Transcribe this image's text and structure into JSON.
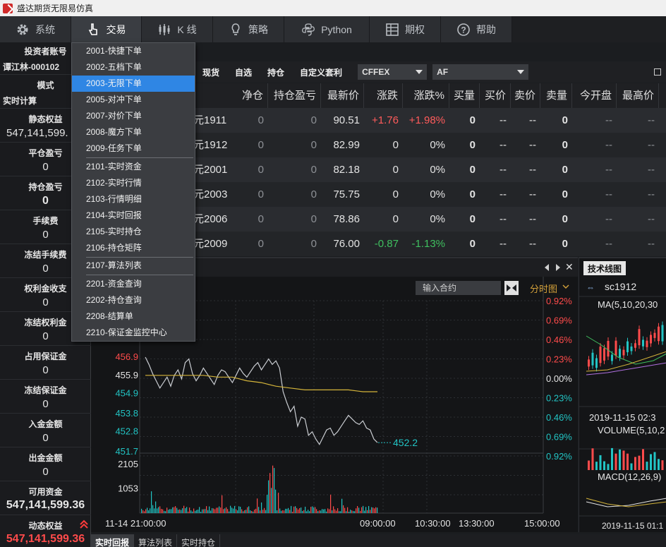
{
  "window": {
    "title": "盛达期货无限易仿真"
  },
  "menubar": {
    "items": [
      {
        "label": "系统",
        "icon": "gear-icon"
      },
      {
        "label": "交易",
        "icon": "hand-pointer-icon"
      },
      {
        "label": "K 线",
        "icon": "candlestick-icon"
      },
      {
        "label": "策略",
        "icon": "lightbulb-icon"
      },
      {
        "label": "Python",
        "icon": "python-icon"
      },
      {
        "label": "期权",
        "icon": "grid-icon"
      },
      {
        "label": "帮助",
        "icon": "help-icon"
      }
    ]
  },
  "account": {
    "rows": [
      {
        "label": "投资者账号",
        "value": "谭江林-000102"
      },
      {
        "label": "模式",
        "value": "实时计算"
      },
      {
        "label": "静态权益",
        "value": "547,141,599."
      },
      {
        "label": "平仓盈亏",
        "value": "0"
      },
      {
        "label": "持仓盈亏",
        "value": "0"
      },
      {
        "label": "手续费",
        "value": "0"
      },
      {
        "label": "冻结手续费",
        "value": "0"
      },
      {
        "label": "权利金收支",
        "value": "0"
      },
      {
        "label": "冻结权利金",
        "value": "0"
      },
      {
        "label": "占用保证金",
        "value": "0"
      },
      {
        "label": "冻结保证金",
        "value": "0"
      },
      {
        "label": "入金金额",
        "value": "0"
      },
      {
        "label": "出金金额",
        "value": "0"
      },
      {
        "label": "可用资金",
        "value": "547,141,599.36"
      },
      {
        "label": "动态权益",
        "value": "547,141,599.36"
      }
    ]
  },
  "dropdown": {
    "items": [
      "2001-快捷下单",
      "2002-五档下单",
      "2003-无限下单",
      "2005-对冲下单",
      "2007-对价下单",
      "2008-魔方下单",
      "2009-任务下单",
      "2101-实时资金",
      "2102-实时行情",
      "2103-行情明细",
      "2104-实时回报",
      "2105-实时持仓",
      "2106-持仓矩阵",
      "2107-算法列表",
      "2201-资金查询",
      "2202-持仓查询",
      "2208-结算单",
      "2210-保证金监控中心"
    ]
  },
  "filters": {
    "tabs": [
      "现货",
      "自选",
      "持仓",
      "自定义套利"
    ],
    "exchange": "CFFEX",
    "product": "AF"
  },
  "quote_table": {
    "headers": [
      "净仓",
      "持仓盈亏",
      "最新价",
      "涨跌",
      "涨跌%",
      "买量",
      "买价",
      "卖价",
      "卖量",
      "今开盘",
      "最高价"
    ],
    "rows": [
      {
        "name": "元1911",
        "net": "0",
        "pnl": "0",
        "last": "90.51",
        "chg": "+1.76",
        "pct": "+1.98%",
        "bidv": "0",
        "bid": "--",
        "ask": "--",
        "askv": "0",
        "open": "--",
        "high": "--",
        "dir": "up"
      },
      {
        "name": "元1912",
        "net": "0",
        "pnl": "0",
        "last": "82.99",
        "chg": "0",
        "pct": "0%",
        "bidv": "0",
        "bid": "--",
        "ask": "--",
        "askv": "0",
        "open": "--",
        "high": "--",
        "dir": "flat"
      },
      {
        "name": "元2001",
        "net": "0",
        "pnl": "0",
        "last": "82.18",
        "chg": "0",
        "pct": "0%",
        "bidv": "0",
        "bid": "--",
        "ask": "--",
        "askv": "0",
        "open": "--",
        "high": "--",
        "dir": "flat"
      },
      {
        "name": "元2003",
        "net": "0",
        "pnl": "0",
        "last": "75.75",
        "chg": "0",
        "pct": "0%",
        "bidv": "0",
        "bid": "--",
        "ask": "--",
        "askv": "0",
        "open": "--",
        "high": "--",
        "dir": "flat"
      },
      {
        "name": "元2006",
        "net": "0",
        "pnl": "0",
        "last": "78.86",
        "chg": "0",
        "pct": "0%",
        "bidv": "0",
        "bid": "--",
        "ask": "--",
        "askv": "0",
        "open": "--",
        "high": "--",
        "dir": "flat"
      },
      {
        "name": "元2009",
        "net": "0",
        "pnl": "0",
        "last": "76.00",
        "chg": "-0.87",
        "pct": "-1.13%",
        "bidv": "0",
        "bid": "--",
        "ask": "--",
        "askv": "0",
        "open": "--",
        "high": "--",
        "dir": "down"
      }
    ]
  },
  "chart": {
    "contract_placeholder": "输入合约",
    "mode": "分时图",
    "last_label": "452.2",
    "price_ticks": [
      "456.9",
      "455.9",
      "454.9",
      "453.8",
      "452.8",
      "451.7"
    ],
    "pct_ticks": [
      "0.92%",
      "0.69%",
      "0.46%",
      "0.23%",
      "0.00%",
      "0.23%",
      "0.46%",
      "0.69%",
      "0.92%"
    ],
    "volume_ticks": [
      "2105",
      "1053"
    ],
    "time_ticks": [
      "11-14 21:00:00",
      "09:00:00",
      "10:30:00",
      "13:30:00",
      "15:00:00"
    ],
    "colors": {
      "price_line": "#c9ccd1",
      "avg_line": "#d4b43a",
      "up": "#ff4b4b",
      "down": "#22c4c4"
    }
  },
  "chart_data": {
    "type": "line",
    "title": "",
    "xlabel": "",
    "ylabel": "",
    "ylim": [
      451.7,
      456.9
    ],
    "series": [
      {
        "values": [
          456.9,
          456.5,
          456.0,
          455.6,
          455.2,
          455.5,
          455.8,
          455.3,
          455.9,
          456.2,
          455.7,
          456.6,
          456.8,
          456.0,
          455.6,
          455.9,
          456.3,
          456.0,
          455.7,
          455.4,
          455.9,
          456.2,
          456.1,
          455.8,
          455.5,
          455.9,
          456.3,
          456.0,
          455.8,
          456.1,
          456.4,
          456.6,
          456.2,
          456.5,
          456.8,
          456.5,
          456.7,
          456.3,
          455.0,
          454.4,
          453.9,
          454.2,
          453.1,
          453.6,
          453.5,
          452.6,
          452.8,
          452.4,
          452.1,
          452.5,
          452.9,
          453.0,
          452.6,
          452.8,
          453.1,
          453.4,
          453.7,
          453.5,
          453.3,
          453.2,
          453.4,
          453.0,
          452.9,
          452.4,
          452.2
        ]
      },
      {
        "values": [
          455.9,
          455.9,
          455.9,
          455.9,
          455.9,
          455.8,
          455.8,
          455.6,
          455.5,
          455.3,
          455.2,
          455.1,
          455.1,
          455.1,
          455.1,
          455.0,
          455.0
        ]
      }
    ]
  },
  "right_panel": {
    "tab": "技术线图",
    "symbol": "sc1912",
    "ma_label": "MA(5,10,20,30",
    "date_label": "2019-11-15 02:3",
    "volume_label": "VOLUME(5,10,2",
    "macd_label": "MACD(12,26,9)",
    "bottom_date": "2019-11-15 01:1"
  },
  "bottom_tabs": [
    "实时回报",
    "算法列表",
    "实时持仓"
  ]
}
